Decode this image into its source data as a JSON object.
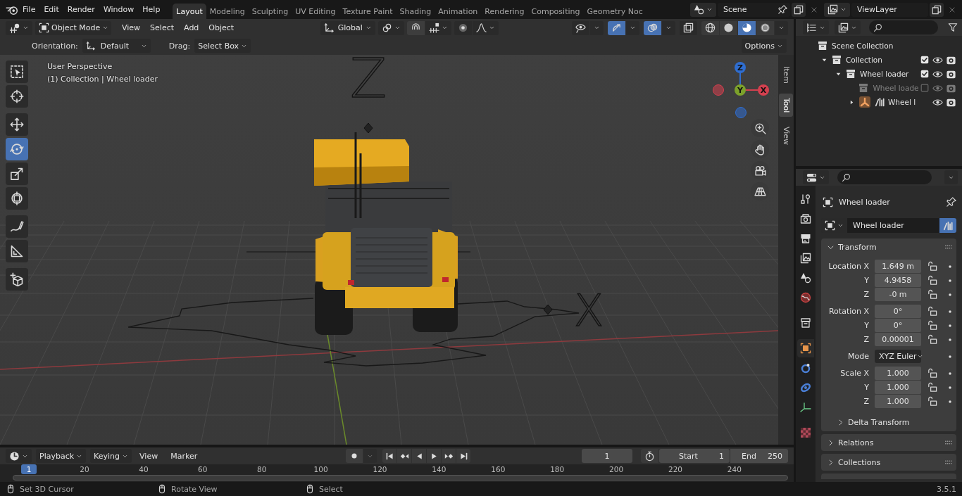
{
  "topbar": {
    "menus": [
      "File",
      "Edit",
      "Render",
      "Window",
      "Help"
    ],
    "workspaces": [
      {
        "label": "Layout",
        "selected": true
      },
      {
        "label": "Modeling",
        "selected": false
      },
      {
        "label": "Sculpting",
        "selected": false
      },
      {
        "label": "UV Editing",
        "selected": false
      },
      {
        "label": "Texture Paint",
        "selected": false
      },
      {
        "label": "Shading",
        "selected": false
      },
      {
        "label": "Animation",
        "selected": false
      },
      {
        "label": "Rendering",
        "selected": false
      },
      {
        "label": "Compositing",
        "selected": false
      },
      {
        "label": "Geometry Noc",
        "selected": false
      }
    ],
    "scene": "Scene",
    "view_layer": "ViewLayer"
  },
  "viewport": {
    "header": {
      "mode": "Object Mode",
      "menus": [
        "View",
        "Select",
        "Add",
        "Object"
      ],
      "orientation": "Global",
      "toggles": [
        {
          "kind": "visibility",
          "on": false
        },
        {
          "kind": "gizmo",
          "on": true
        },
        {
          "kind": "overlay",
          "on": true
        },
        {
          "kind": "xray",
          "on": false
        }
      ],
      "shading": [
        {
          "kind": "wireframe",
          "selected": false
        },
        {
          "kind": "solid",
          "selected": false
        },
        {
          "kind": "material",
          "selected": true
        },
        {
          "kind": "rendered",
          "selected": false
        }
      ]
    },
    "tool_settings": {
      "orientation_label": "Orientation:",
      "orientation": "Default",
      "drag_label": "Drag:",
      "drag": "Select Box",
      "options": "Options"
    },
    "tool_groups": [
      [
        {
          "kind": "select",
          "selected": false
        },
        {
          "kind": "cursor",
          "selected": false
        }
      ],
      [
        {
          "kind": "move",
          "selected": false
        },
        {
          "kind": "rotate",
          "selected": true
        },
        {
          "kind": "scale",
          "selected": false
        },
        {
          "kind": "transform",
          "selected": false
        }
      ],
      [
        {
          "kind": "annotate",
          "selected": false
        },
        {
          "kind": "measure",
          "selected": false
        }
      ],
      [
        {
          "kind": "add_cube",
          "selected": false
        }
      ]
    ],
    "overlay_text": [
      "User Perspective",
      "(1) Collection | Wheel loader"
    ],
    "scene_marks": [
      "Z",
      "X"
    ],
    "gizmo_axes": [
      {
        "label": "X",
        "color": "#d4404f"
      },
      {
        "label": "Y",
        "color": "#7ca12b"
      },
      {
        "label": "Z",
        "color": "#2f6ed1"
      }
    ],
    "sidebar_tabs": [
      {
        "label": "Item",
        "selected": false
      },
      {
        "label": "Tool",
        "selected": true
      },
      {
        "label": "View",
        "selected": false
      }
    ]
  },
  "timeline": {
    "menus": [
      {
        "label": "Playback",
        "kind": "dropdown"
      },
      {
        "label": "Keying",
        "kind": "dropdown"
      },
      {
        "label": "View",
        "kind": "menu"
      },
      {
        "label": "Marker",
        "kind": "menu"
      }
    ],
    "current_frame": "1",
    "start": {
      "label": "Start",
      "value": "1"
    },
    "end": {
      "label": "End",
      "value": "250"
    },
    "ruler": {
      "current": "1",
      "ticks": [
        "20",
        "40",
        "60",
        "80",
        "100",
        "120",
        "140",
        "160",
        "180",
        "200",
        "220",
        "240"
      ]
    }
  },
  "outliner": {
    "tree": {
      "label": "Scene Collection",
      "kind": "collection",
      "children": [
        {
          "label": "Collection",
          "kind": "collection",
          "expanded": true,
          "checked": true,
          "excluded": false,
          "children": [
            {
              "label": "Wheel loader",
              "kind": "collection",
              "expanded": true,
              "checked": true,
              "excluded": false,
              "children": [
                {
                  "label": "Wheel loade",
                  "kind": "collection",
                  "checked": false,
                  "excluded": true
                },
                {
                  "label": "Wheel l",
                  "kind": "object",
                  "expanded": false,
                  "excluded": false
                }
              ]
            }
          ]
        }
      ]
    }
  },
  "properties": {
    "tabs": [
      {
        "kind": "tool",
        "selected": false
      },
      {
        "kind": "render",
        "selected": false
      },
      {
        "kind": "output",
        "selected": false
      },
      {
        "kind": "view_layer",
        "selected": false
      },
      {
        "kind": "scene",
        "selected": false
      },
      {
        "kind": "world",
        "selected": false
      },
      {
        "kind": "collection",
        "selected": false
      },
      {
        "kind": "object",
        "selected": true
      },
      {
        "kind": "physics",
        "selected": false
      },
      {
        "kind": "constraints",
        "selected": false
      },
      {
        "kind": "data",
        "selected": false
      },
      {
        "kind": "texture",
        "selected": false
      }
    ],
    "object_name": "Wheel loader",
    "datablock": "Wheel loader",
    "panels": [
      {
        "title": "Transform",
        "expanded": true,
        "groups": [
          [
            {
              "label": "Location X",
              "value": "1.649 m",
              "kind": "field"
            },
            {
              "label": "Y",
              "value": "4.9458",
              "kind": "field"
            },
            {
              "label": "Z",
              "value": "-0 m",
              "kind": "field"
            }
          ],
          [
            {
              "label": "Rotation X",
              "value": "0°",
              "kind": "field"
            },
            {
              "label": "Y",
              "value": "0°",
              "kind": "field"
            },
            {
              "label": "Z",
              "value": "0.00001",
              "kind": "field"
            }
          ],
          [
            {
              "label": "Mode",
              "value": "XYZ Euler",
              "kind": "dropdown"
            }
          ],
          [
            {
              "label": "Scale X",
              "value": "1.000",
              "kind": "field"
            },
            {
              "label": "Y",
              "value": "1.000",
              "kind": "field"
            },
            {
              "label": "Z",
              "value": "1.000",
              "kind": "field"
            }
          ]
        ],
        "subpanels": [
          {
            "title": "Delta Transform",
            "expanded": false
          }
        ]
      },
      {
        "title": "Relations",
        "expanded": false
      },
      {
        "title": "Collections",
        "expanded": false
      }
    ]
  },
  "status_bar": {
    "hints": [
      "Set 3D Cursor",
      "Rotate View",
      "Select"
    ],
    "version": "3.5.1"
  }
}
